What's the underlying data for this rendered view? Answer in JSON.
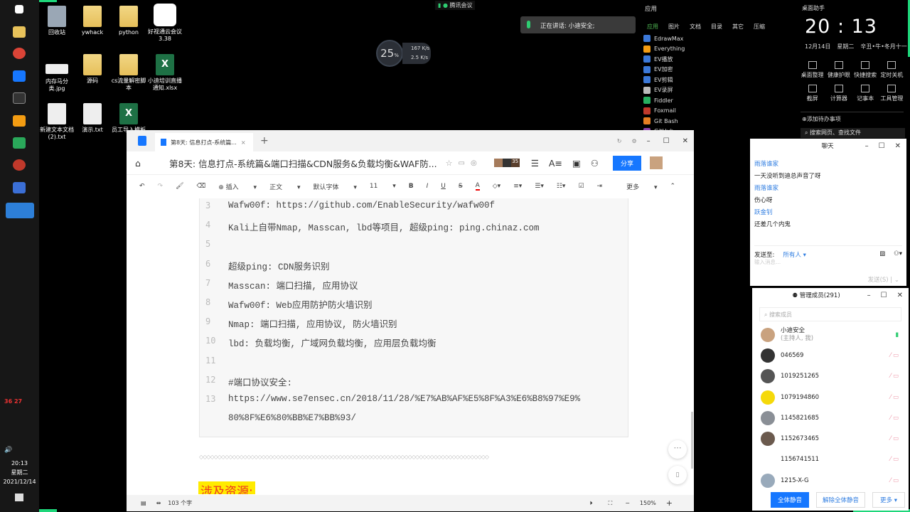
{
  "taskbar": {
    "time": "20:13",
    "weekday": "星期二",
    "date": "2021/12/14",
    "tray_nums": [
      "36",
      "27"
    ]
  },
  "desktop_icons": [
    {
      "label": "回收站",
      "type": "recycle"
    },
    {
      "label": "ywhack",
      "type": "folder"
    },
    {
      "label": "python",
      "type": "folder"
    },
    {
      "label": "好视通云会议3.38",
      "type": "app"
    },
    {
      "label": "内存马分类.jpg",
      "type": "image"
    },
    {
      "label": "源码",
      "type": "folder"
    },
    {
      "label": "cs流量解密脚本",
      "type": "folder"
    },
    {
      "label": "小迪培训直播通知.xlsx",
      "type": "xls"
    },
    {
      "label": "新建文本文档(2).txt",
      "type": "file"
    },
    {
      "label": "演示.txt",
      "type": "file"
    },
    {
      "label": "员工导入模板",
      "type": "xls"
    }
  ],
  "meeting": {
    "app": "腾讯会议",
    "speaking": "正在讲话: 小迪安全;"
  },
  "perf": {
    "cpu": "25",
    "unit": "%",
    "up": "167",
    "down": "2.5",
    "rate_unit": "K/s"
  },
  "apps_panel": {
    "title": "应用",
    "tabs": [
      "应用",
      "图片",
      "文档",
      "目录",
      "其它",
      "压缩"
    ],
    "items": [
      "EdrawMax",
      "Everything",
      "EV播放",
      "EV加密",
      "EV剪辑",
      "EV录屏",
      "Fiddler",
      "Foxmail",
      "Git Bash",
      "GitHub"
    ]
  },
  "helper": {
    "title": "桌面助手",
    "time": "20 : 13",
    "date": "12月14日",
    "weekday": "星期二",
    "lunar": "辛丑•牛•冬月十一",
    "tools": [
      "桌面整理",
      "健康护眼",
      "快捷搜索",
      "定时关机",
      "截屏",
      "计算器",
      "记事本",
      "工具管理"
    ],
    "todo": "添加待办事项",
    "search": "搜索网页、查找文件"
  },
  "doc": {
    "tab": "第8天: 信息打点-系统篇...",
    "title": "第8天: 信息打点-系统篇&端口扫描&CDN服务&负载均衡&WAF防...",
    "share": "分享",
    "badge": "35",
    "toolbar": {
      "insert": "插入",
      "style": "正文",
      "font": "默认字体",
      "size": "11",
      "more": "更多"
    },
    "lines": [
      {
        "n": "3",
        "t": "Wafw00f: https://github.com/EnableSecurity/wafw00f"
      },
      {
        "n": "4",
        "t": "Kali上自带Nmap, Masscan, lbd等项目, 超级ping: ping.chinaz.com"
      },
      {
        "n": "5",
        "t": ""
      },
      {
        "n": "6",
        "t": "超级ping: CDN服务识别"
      },
      {
        "n": "7",
        "t": "Masscan: 端口扫描, 应用协议"
      },
      {
        "n": "8",
        "t": "Wafw00f: Web应用防护防火墙识别"
      },
      {
        "n": "9",
        "t": "Nmap: 端口扫描, 应用协议, 防火墙识别"
      },
      {
        "n": "10",
        "t": "lbd: 负载均衡, 广域网负载均衡, 应用层负载均衡"
      },
      {
        "n": "11",
        "t": ""
      },
      {
        "n": "12",
        "t": "#端口协议安全:"
      },
      {
        "n": "13",
        "t": "https://www.se7ensec.cn/2018/11/28/%E7%AB%AF%E5%8F%A3%E6%B8%97%E9%"
      },
      {
        "n": "",
        "t": "80%8F%E6%80%BB%E7%BB%93/"
      }
    ],
    "heading": "涉及资源:",
    "word_count": "103 个字",
    "zoom": "150%"
  },
  "chat": {
    "title": "聊天",
    "messages": [
      {
        "user": "雨落谁家",
        "text": "一天没听到迪总声音了呀"
      },
      {
        "user": "雨落谁家",
        "text": "伤心呀"
      },
      {
        "user": "跃金钊",
        "text": "还差几个内鬼"
      }
    ],
    "send_to_label": "发送至:",
    "send_to": "所有人",
    "placeholder": "输入消息...",
    "send": "发送(S)"
  },
  "members": {
    "title": "管理成员(291)",
    "search": "搜索成员",
    "host": {
      "name": "小迪安全",
      "role": "(主持人, 我)"
    },
    "list": [
      "046569",
      "1019251265",
      "1079194860",
      "1145821685",
      "1152673465",
      "1156741511",
      "1215-X-G"
    ],
    "mute_all": "全体静音",
    "unmute_all": "解除全体静音",
    "more": "更多"
  },
  "accent": "#1677ff",
  "border_green": "#1ed67a"
}
